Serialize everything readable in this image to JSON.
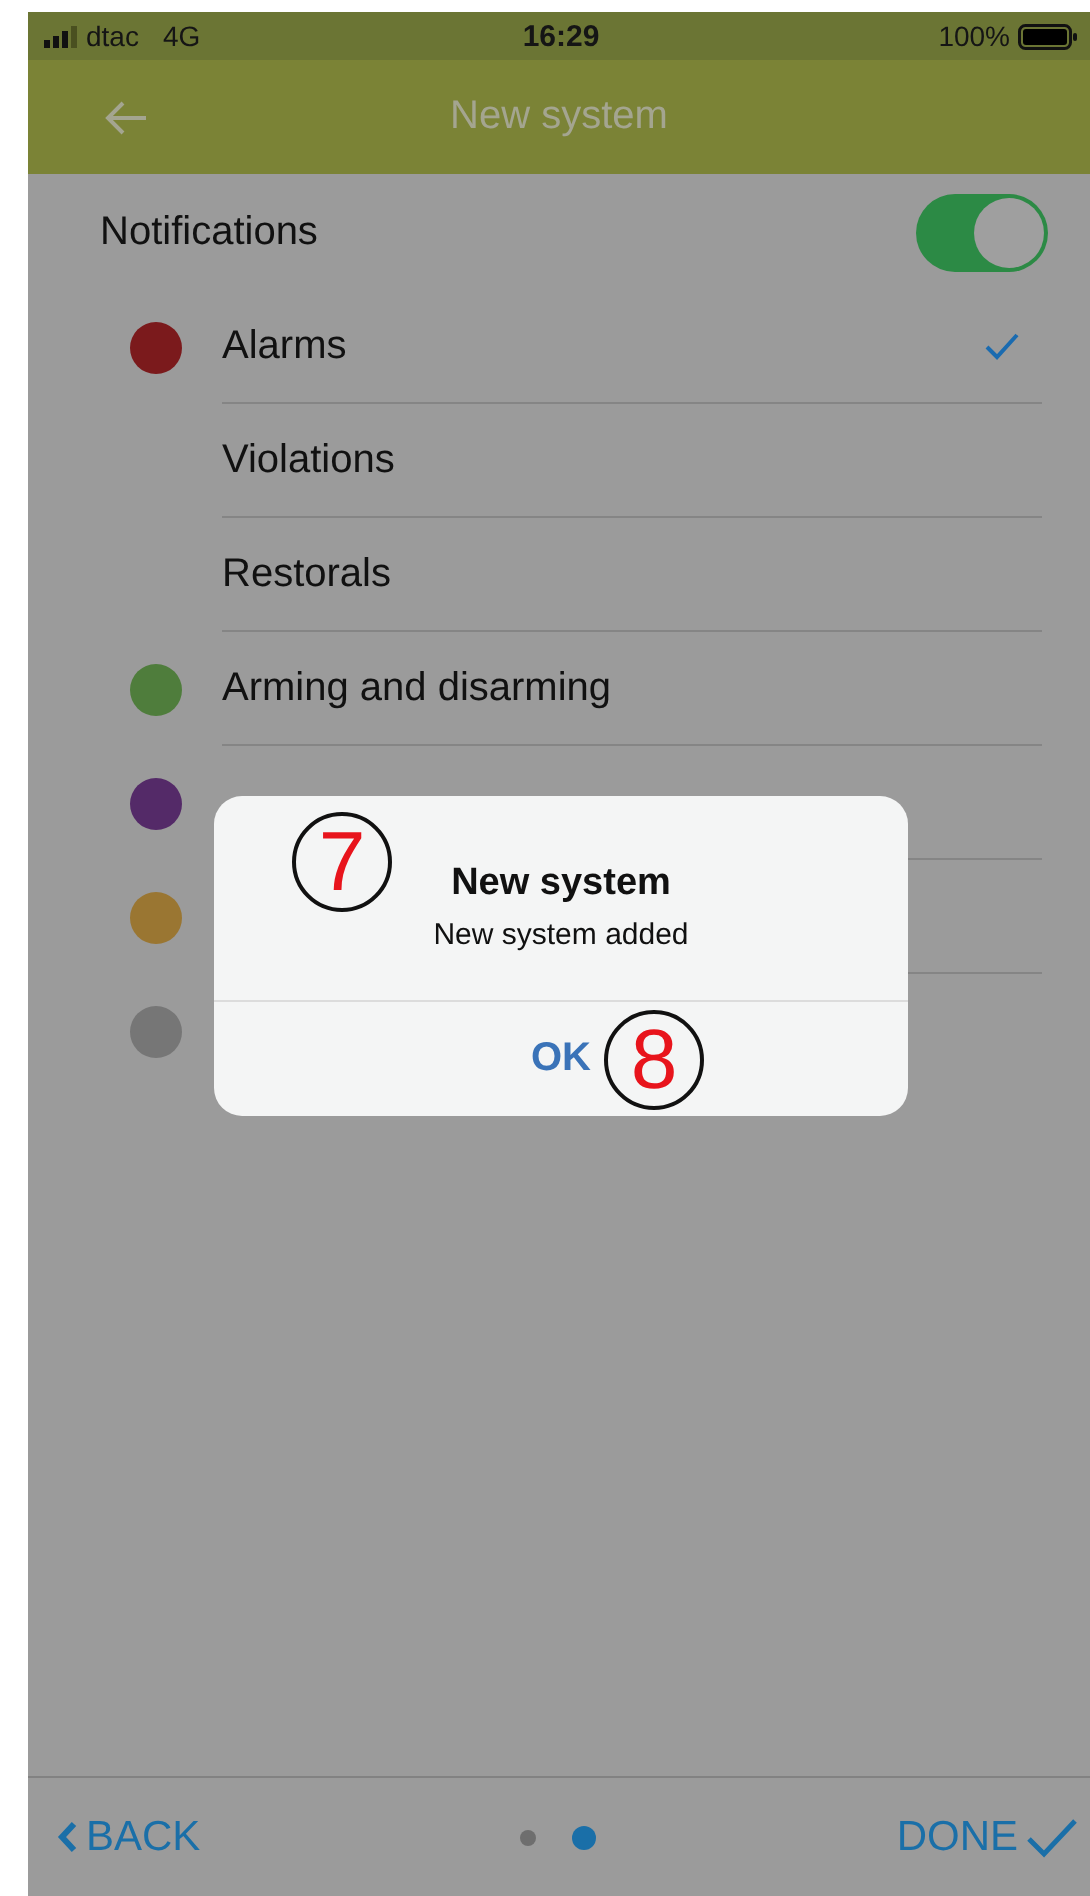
{
  "status_bar": {
    "carrier": "dtac",
    "network": "4G",
    "time": "16:29",
    "battery": "100%"
  },
  "header": {
    "title": "New system"
  },
  "notifications": {
    "label": "Notifications",
    "on": true
  },
  "items": [
    {
      "label": "Alarms",
      "color": "#7b1a1c",
      "checked": true
    },
    {
      "label": "Violations",
      "checked": false
    },
    {
      "label": "Restorals",
      "checked": false
    },
    {
      "label": "Arming and disarming",
      "color": "#4f7d3c",
      "checked": false
    },
    {
      "color": "#542a68",
      "checked": false
    },
    {
      "color": "#9a7632",
      "checked": false
    },
    {
      "color": "#767676",
      "checked": false
    }
  ],
  "dialog": {
    "title": "New system",
    "message": "New system added",
    "button": "OK"
  },
  "annotations": [
    {
      "label": "7"
    },
    {
      "label": "8"
    }
  ],
  "footer": {
    "back": "BACK",
    "done": "DONE",
    "pages": [
      {
        "selected": false
      },
      {
        "selected": true
      }
    ]
  }
}
